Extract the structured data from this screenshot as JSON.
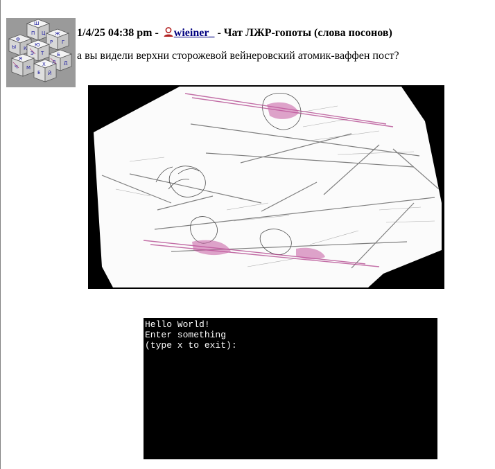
{
  "post": {
    "timestamp": "1/4/25 04:38 pm",
    "separator_1": " - ",
    "username": "wieiner_",
    "separator_2": " - ",
    "thread_title": "Чат ЛЖР-гопоты (слова посонов)",
    "message": "а вы видели верхни сторожевой вейнеровский атомик-ваффен пост?"
  },
  "console": {
    "lines": [
      "Hello World!",
      "Enter something",
      "(type x to exit):"
    ]
  },
  "icons": {
    "user": "user-icon",
    "avatar": "cube-stack-avatar"
  },
  "colors": {
    "username_link": "#000080",
    "console_bg": "#000000",
    "console_text": "#ffffff",
    "image_frame": "#000000",
    "user_icon": "#b22222"
  }
}
